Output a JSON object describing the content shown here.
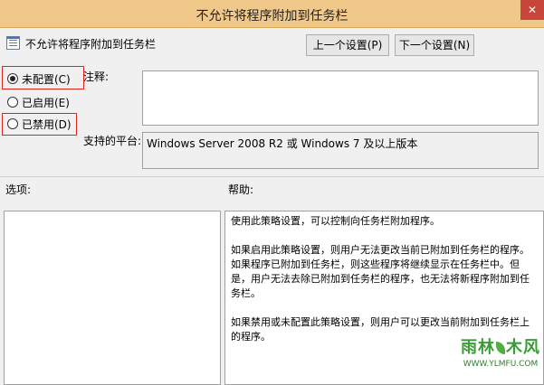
{
  "window": {
    "title": "不允许将程序附加到任务栏",
    "close_glyph": "✕"
  },
  "header": {
    "policy_name": "不允许将程序附加到任务栏",
    "prev_button": "上一个设置(P)",
    "next_button": "下一个设置(N)"
  },
  "state": {
    "options": [
      {
        "label": "未配置(C)",
        "selected": true
      },
      {
        "label": "已启用(E)",
        "selected": false
      },
      {
        "label": "已禁用(D)",
        "selected": false
      }
    ]
  },
  "fields": {
    "comment_label": "注释:",
    "comment_value": "",
    "platform_label": "支持的平台:",
    "platform_value": "Windows Server 2008 R2 或 Windows 7 及以上版本"
  },
  "sections": {
    "options_label": "选项:",
    "help_label": "帮助:"
  },
  "help": {
    "paragraphs": [
      "使用此策略设置，可以控制向任务栏附加程序。",
      "如果启用此策略设置，则用户无法更改当前已附加到任务栏的程序。如果程序已附加到任务栏，则这些程序将继续显示在任务栏中。但是，用户无法去除已附加到任务栏的程序，也无法将新程序附加到任务栏。",
      "如果禁用或未配置此策略设置，则用户可以更改当前附加到任务栏上的程序。"
    ]
  },
  "watermark": {
    "main_left": "雨林",
    "main_right": "木风",
    "url": "WWW.YLMFU.COM"
  }
}
